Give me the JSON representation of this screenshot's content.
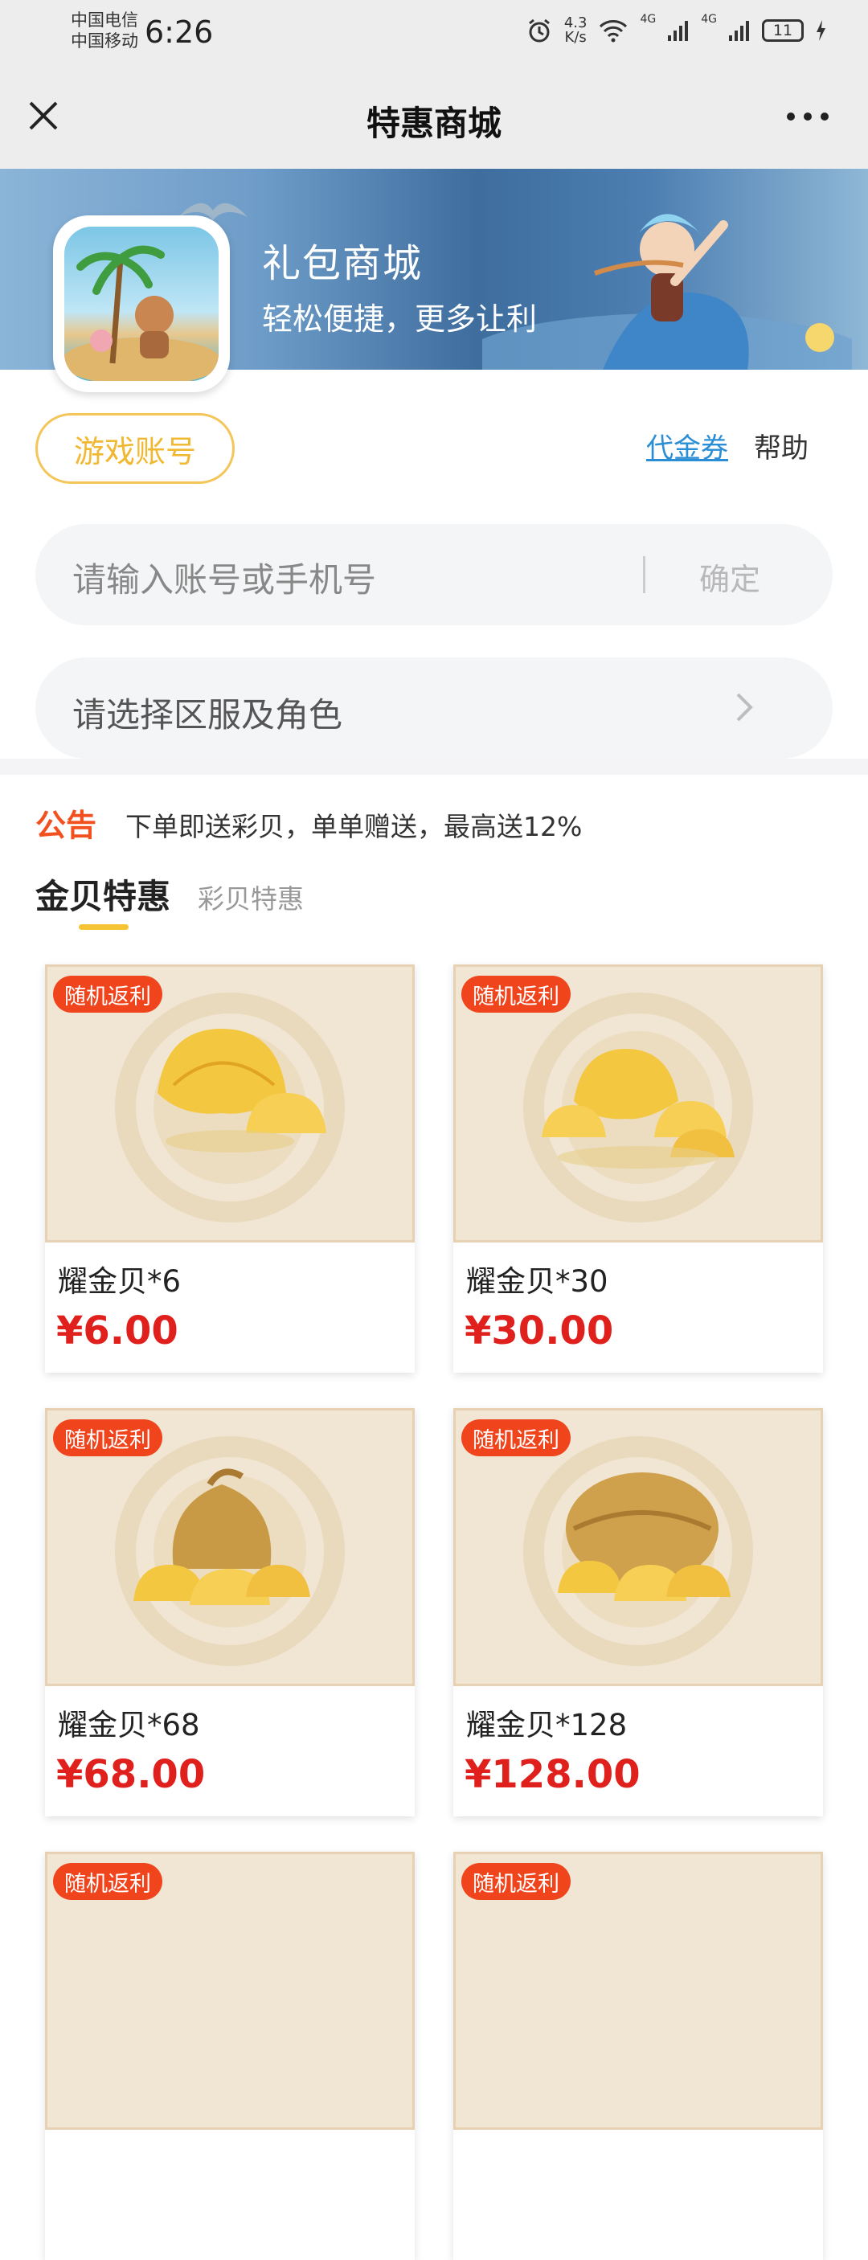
{
  "status_bar": {
    "carrier1": "中国电信",
    "carrier2": "中国移动",
    "time": "6:26",
    "net_speed_value": "4.3",
    "net_speed_unit": "K/s",
    "signal1": "4G",
    "signal2": "4G",
    "battery": "11"
  },
  "header": {
    "title": "特惠商城"
  },
  "banner": {
    "title": "礼包商城",
    "subtitle": "轻松便捷，更多让利"
  },
  "account": {
    "button_label": "游戏账号",
    "voucher_link": "代金券",
    "help_link": "帮助",
    "input_placeholder": "请输入账号或手机号",
    "confirm_label": "确定",
    "select_placeholder": "请选择区服及角色"
  },
  "notice": {
    "label": "公告",
    "text": "下单即送彩贝，单单赠送，最高送12%"
  },
  "tabs": [
    {
      "label": "金贝特惠",
      "active": true
    },
    {
      "label": "彩贝特惠",
      "active": false
    }
  ],
  "products": [
    {
      "badge": "随机返利",
      "name": "耀金贝*6",
      "price": "¥6.00",
      "image": "shell-pile-icon"
    },
    {
      "badge": "随机返利",
      "name": "耀金贝*30",
      "price": "¥30.00",
      "image": "shell-pile-icon"
    },
    {
      "badge": "随机返利",
      "name": "耀金贝*68",
      "price": "¥68.00",
      "image": "shell-bag-icon"
    },
    {
      "badge": "随机返利",
      "name": "耀金贝*128",
      "price": "¥128.00",
      "image": "shell-bag-icon"
    },
    {
      "badge": "随机返利"
    },
    {
      "badge": "随机返利"
    }
  ],
  "colors": {
    "accent_yellow": "#f1b832",
    "price_red": "#e0201c",
    "badge_red": "#f0441d",
    "link_blue": "#2a8ed6"
  }
}
